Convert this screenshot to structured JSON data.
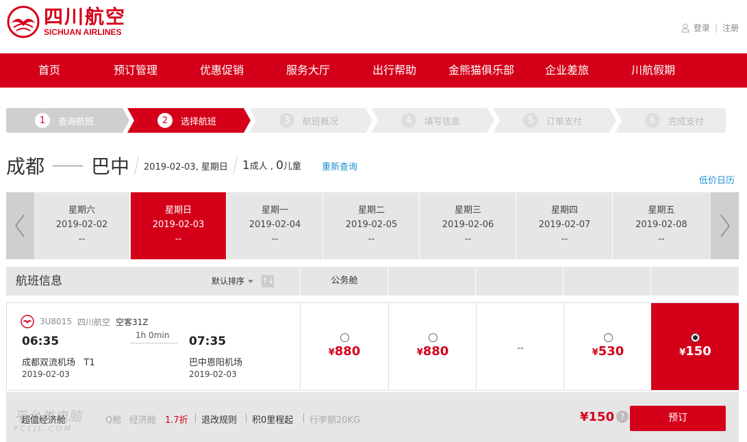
{
  "brand": {
    "name_cn": "四川航空",
    "name_en": "SICHUAN AIRLINES",
    "color": "#d4001a"
  },
  "account": {
    "login": "登录",
    "register": "注册"
  },
  "nav": [
    "首页",
    "预订管理",
    "优惠促销",
    "服务大厅",
    "出行帮助",
    "金熊猫俱乐部",
    "企业差旅",
    "川航假期"
  ],
  "steps": [
    {
      "num": "1",
      "label": "查询航班",
      "state": "done"
    },
    {
      "num": "2",
      "label": "选择航班",
      "state": "current"
    },
    {
      "num": "3",
      "label": "航班概况",
      "state": "todo"
    },
    {
      "num": "4",
      "label": "填写信息",
      "state": "todo"
    },
    {
      "num": "5",
      "label": "订单支付",
      "state": "todo"
    },
    {
      "num": "6",
      "label": "完成支付",
      "state": "todo"
    }
  ],
  "route": {
    "from": "成都",
    "to": "巴中",
    "date": "2019-02-03, 星期日",
    "adults_num": "1",
    "adults_label": "成人 ,",
    "children_num": "0",
    "children_label": "儿童",
    "requery": "重新查询",
    "low_price_calendar": "低价日历"
  },
  "dates": [
    {
      "weekday": "星期六",
      "date": "2019-02-02",
      "price": "--"
    },
    {
      "weekday": "星期日",
      "date": "2019-02-03",
      "price": "--",
      "active": true
    },
    {
      "weekday": "星期一",
      "date": "2019-02-04",
      "price": "--"
    },
    {
      "weekday": "星期二",
      "date": "2019-02-05",
      "price": "--"
    },
    {
      "weekday": "星期三",
      "date": "2019-02-06",
      "price": "--"
    },
    {
      "weekday": "星期四",
      "date": "2019-02-07",
      "price": "--"
    },
    {
      "weekday": "星期五",
      "date": "2019-02-08",
      "price": "--"
    }
  ],
  "table": {
    "flight_info_header": "航班信息",
    "sort_label": "默认排序",
    "sort_icon": "↑↓",
    "cabin_headers": [
      "公务舱",
      "",
      "",
      "",
      ""
    ]
  },
  "flight": {
    "code": "3U8015",
    "airline": "四川航空",
    "aircraft": "空客31Z",
    "dep_time": "06:35",
    "arr_time": "07:35",
    "duration": "1h 0min",
    "dep_airport": "成都双流机场",
    "dep_terminal": "T1",
    "arr_airport": "巴中恩阳机场",
    "dep_date": "2019-02-03",
    "arr_date": "2019-02-03",
    "fares": [
      {
        "price": "880",
        "currency": "¥",
        "available": true,
        "selected": false
      },
      {
        "price": "880",
        "currency": "¥",
        "available": true,
        "selected": false
      },
      {
        "price": "--",
        "currency": "",
        "available": false,
        "selected": false
      },
      {
        "price": "530",
        "currency": "¥",
        "available": true,
        "selected": false
      },
      {
        "price": "150",
        "currency": "¥",
        "available": true,
        "selected": true
      }
    ]
  },
  "detail": {
    "cabin_name": "超值经济舱",
    "cabin_code": "Q舱",
    "cabin_class": "经济舱",
    "discount": "1.7折",
    "refund_rules": "退改规则",
    "mileage": "积0里程起",
    "baggage": "行李额20KG",
    "total_currency": "¥",
    "total": "150",
    "help": "?",
    "book": "预订"
  },
  "watermark": {
    "line1": "平台类电脑",
    "line2": "PCLJL.COM"
  }
}
